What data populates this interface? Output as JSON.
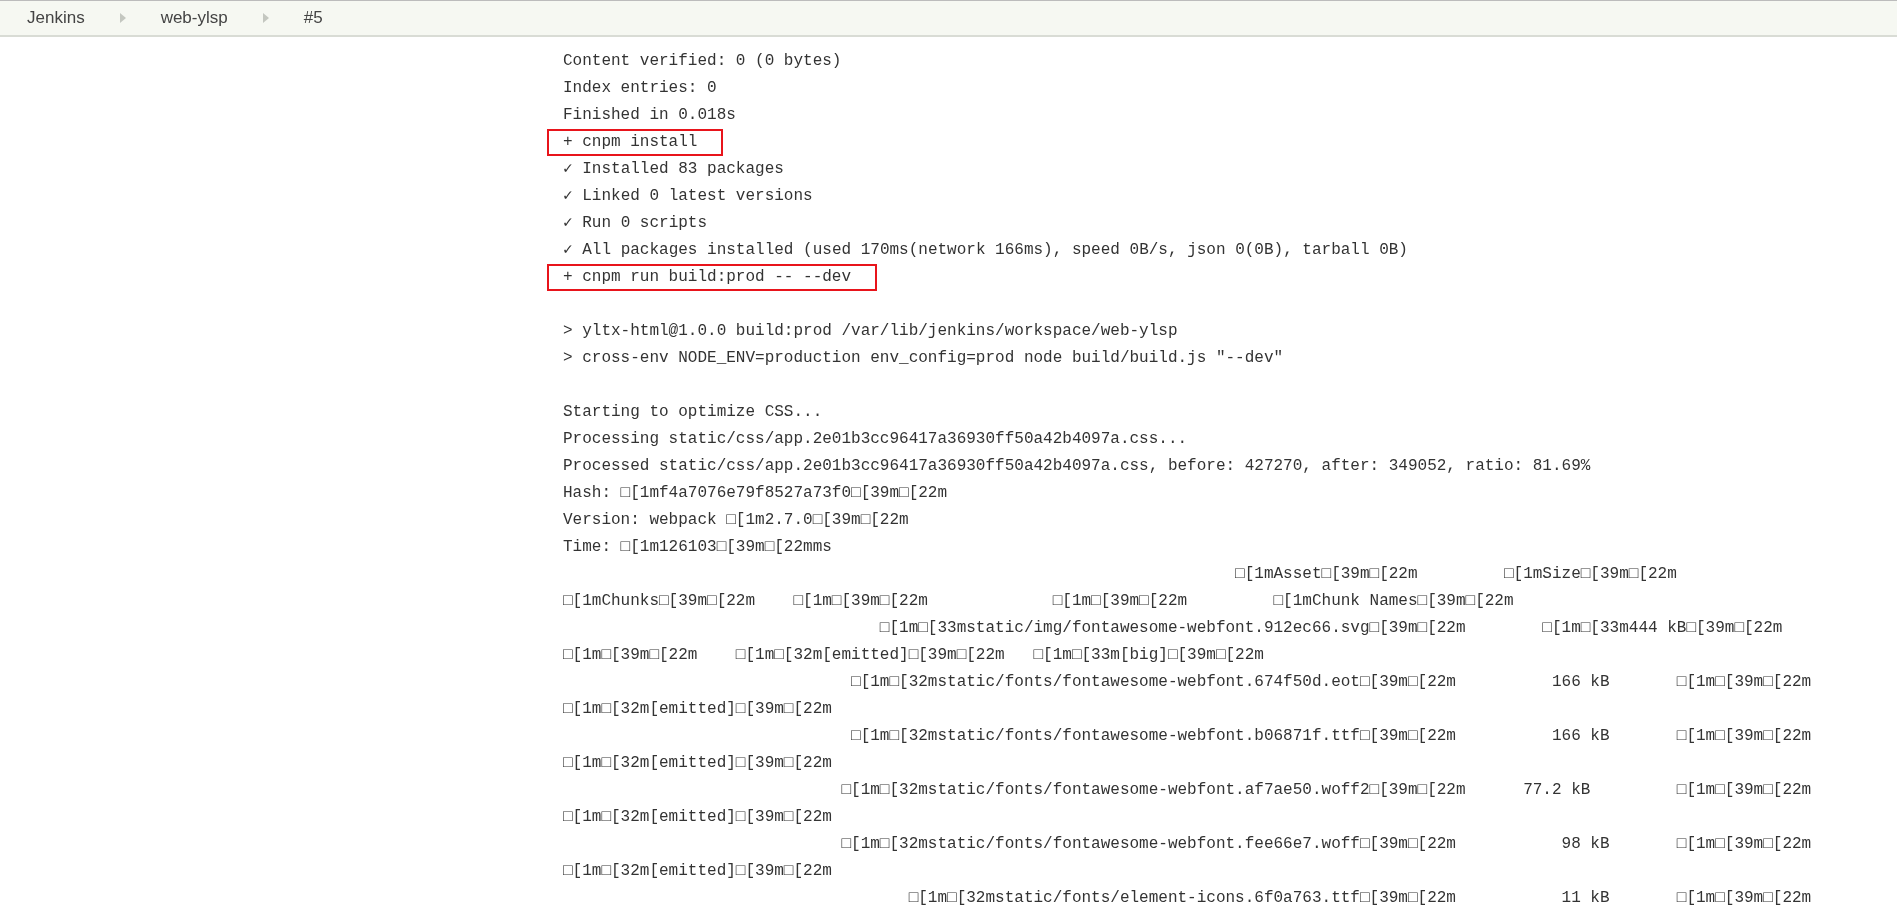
{
  "breadcrumbs": [
    {
      "label": "Jenkins"
    },
    {
      "label": "web-ylsp"
    },
    {
      "label": "#5"
    }
  ],
  "console": {
    "lines": [
      {
        "kind": "plain",
        "text": "Content verified: 0 (0 bytes)"
      },
      {
        "kind": "plain",
        "text": "Index entries: 0"
      },
      {
        "kind": "plain",
        "text": "Finished in 0.018s"
      },
      {
        "kind": "boxed",
        "text": "+ cnpm install"
      },
      {
        "kind": "plain",
        "text": "✓ Installed 83 packages"
      },
      {
        "kind": "plain",
        "text": "✓ Linked 0 latest versions"
      },
      {
        "kind": "plain",
        "text": "✓ Run 0 scripts"
      },
      {
        "kind": "plain",
        "text": "✓ All packages installed (used 170ms(network 166ms), speed 0B/s, json 0(0B), tarball 0B)"
      },
      {
        "kind": "boxed",
        "text": "+ cnpm run build:prod -- --dev"
      },
      {
        "kind": "blank"
      },
      {
        "kind": "plain",
        "text": "> yltx-html@1.0.0 build:prod /var/lib/jenkins/workspace/web-ylsp"
      },
      {
        "kind": "plain",
        "text": "> cross-env NODE_ENV=production env_config=prod node build/build.js \"--dev\""
      },
      {
        "kind": "blank"
      },
      {
        "kind": "plain",
        "text": "Starting to optimize CSS..."
      },
      {
        "kind": "plain",
        "text": "Processing static/css/app.2e01b3cc96417a36930ff50a42b4097a.css..."
      },
      {
        "kind": "plain",
        "text": "Processed static/css/app.2e01b3cc96417a36930ff50a42b4097a.css, before: 427270, after: 349052, ratio: 81.69%"
      },
      {
        "kind": "plain",
        "text": "Hash: □[1mf4a7076e79f8527a73f0□[39m□[22m"
      },
      {
        "kind": "plain",
        "text": "Version: webpack □[1m2.7.0□[39m□[22m"
      },
      {
        "kind": "plain",
        "text": "Time: □[1m126103□[39m□[22mms"
      },
      {
        "kind": "plain",
        "text": "                                                                      □[1mAsset□[39m□[22m         □[1mSize□[39m□[22m"
      },
      {
        "kind": "plain",
        "text": "□[1mChunks□[39m□[22m    □[1m□[39m□[22m             □[1m□[39m□[22m         □[1mChunk Names□[39m□[22m"
      },
      {
        "kind": "plain",
        "text": "                                 □[1m□[33mstatic/img/fontawesome-webfont.912ec66.svg□[39m□[22m        □[1m□[33m444 kB□[39m□[22m"
      },
      {
        "kind": "plain",
        "text": "□[1m□[39m□[22m    □[1m□[32m[emitted]□[39m□[22m   □[1m□[33m[big]□[39m□[22m"
      },
      {
        "kind": "plain",
        "text": "                              □[1m□[32mstatic/fonts/fontawesome-webfont.674f50d.eot□[39m□[22m          166 kB       □[1m□[39m□[22m"
      },
      {
        "kind": "plain",
        "text": "□[1m□[32m[emitted]□[39m□[22m"
      },
      {
        "kind": "plain",
        "text": "                              □[1m□[32mstatic/fonts/fontawesome-webfont.b06871f.ttf□[39m□[22m          166 kB       □[1m□[39m□[22m"
      },
      {
        "kind": "plain",
        "text": "□[1m□[32m[emitted]□[39m□[22m"
      },
      {
        "kind": "plain",
        "text": "                             □[1m□[32mstatic/fonts/fontawesome-webfont.af7ae50.woff2□[39m□[22m      77.2 kB         □[1m□[39m□[22m"
      },
      {
        "kind": "plain",
        "text": "□[1m□[32m[emitted]□[39m□[22m"
      },
      {
        "kind": "plain",
        "text": "                             □[1m□[32mstatic/fonts/fontawesome-webfont.fee66e7.woff□[39m□[22m           98 kB       □[1m□[39m□[22m"
      },
      {
        "kind": "plain",
        "text": "□[1m□[32m[emitted]□[39m□[22m"
      },
      {
        "kind": "plain",
        "text": "                                    □[1m□[32mstatic/fonts/element-icons.6f0a763.ttf□[39m□[22m           11 kB       □[1m□[39m□[22m"
      }
    ]
  }
}
